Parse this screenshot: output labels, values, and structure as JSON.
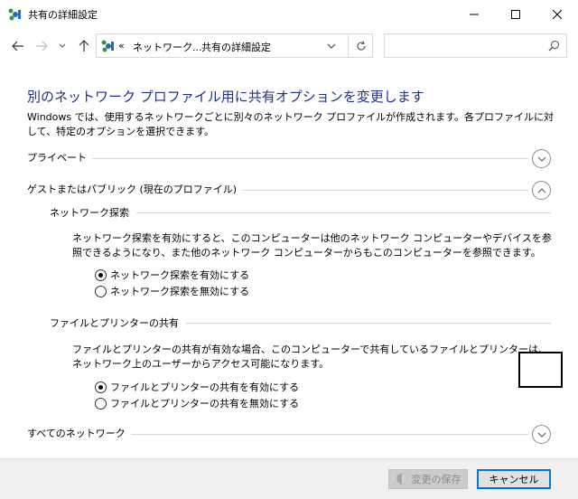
{
  "window": {
    "title": "共有の詳細設定",
    "minimize_icon": "minimize-icon",
    "maximize_icon": "maximize-icon",
    "close_icon": "close-icon"
  },
  "navigation": {
    "address": {
      "overflow": "«",
      "crumbs": [
        "ネットワーク...",
        "共有の詳細設定"
      ]
    },
    "search": {
      "placeholder": "",
      "icon": "search-icon"
    }
  },
  "main": {
    "title": "別のネットワーク プロファイル用に共有オプションを変更します",
    "description": "Windows では、使用するネットワークごとに別々のネットワーク プロファイルが作成されます。各プロファイルに対して、特定のオプションを選択できます。",
    "private_section": "プライベート",
    "guest_section": "ゲストまたはパブリック (現在のプロファイル)",
    "network_discovery": {
      "heading": "ネットワーク探索",
      "description": "ネットワーク探索を有効にすると、このコンピューターは他のネットワーク コンピューターやデバイスを参照できるようになり、また他のネットワーク コンピューターからもこのコンピューターを参照できます。",
      "options": [
        {
          "label": "ネットワーク探索を有効にする",
          "checked": true
        },
        {
          "label": "ネットワーク探索を無効にする",
          "checked": false
        }
      ]
    },
    "file_printer_sharing": {
      "heading": "ファイルとプリンターの共有",
      "description": "ファイルとプリンターの共有が有効な場合、このコンピューターで共有しているファイルとプリンターは、ネットワーク上のユーザーからアクセス可能になります。",
      "options": [
        {
          "label": "ファイルとプリンターの共有を有効にする",
          "checked": true
        },
        {
          "label": "ファイルとプリンターの共有を無効にする",
          "checked": false
        }
      ]
    },
    "all_networks_section": "すべてのネットワーク"
  },
  "footer": {
    "save_label": "変更の保存",
    "cancel_label": "キャンセル"
  },
  "colors": {
    "title_blue": "#1e3287",
    "accent": "#0078d7"
  }
}
